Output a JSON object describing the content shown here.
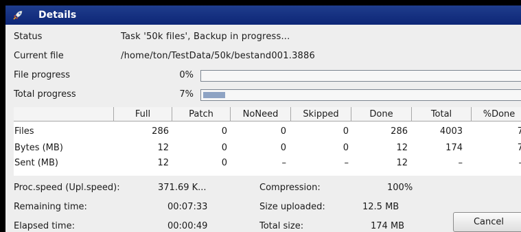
{
  "window": {
    "title": "Details",
    "icon": "rocket-icon"
  },
  "status": {
    "label": "Status",
    "value": "Task '50k files', Backup in progress..."
  },
  "current_file": {
    "label": "Current file",
    "value": "/home/ton/TestData/50k/bestand001.3886"
  },
  "file_progress": {
    "label": "File progress",
    "percent_text": "0%",
    "percent": 0
  },
  "total_progress": {
    "label": "Total progress",
    "percent_text": "7%",
    "percent": 7
  },
  "stats_table": {
    "columns": [
      "",
      "Full",
      "Patch",
      "NoNeed",
      "Skipped",
      "Done",
      "Total",
      "%Done"
    ],
    "rows": [
      {
        "label": "Files",
        "cells": [
          "286",
          "0",
          "0",
          "0",
          "286",
          "4003",
          "7"
        ]
      },
      {
        "label": "Bytes (MB)",
        "cells": [
          "12",
          "0",
          "0",
          "0",
          "12",
          "174",
          "7"
        ]
      },
      {
        "label": "Sent (MB)",
        "cells": [
          "12",
          "0",
          "–",
          "–",
          "12",
          "–",
          "–"
        ]
      }
    ]
  },
  "summary": {
    "proc_speed_label": "Proc.speed (Upl.speed):",
    "proc_speed_value": "371.69 K...",
    "remaining_label": "Remaining time:",
    "remaining_value": "00:07:33",
    "elapsed_label": "Elapsed time:",
    "elapsed_value": "00:00:49",
    "compression_label": "Compression:",
    "compression_value": "100%",
    "size_uploaded_label": "Size uploaded:",
    "size_uploaded_value": "12.5 MB",
    "total_size_label": "Total size:",
    "total_size_value": "174 MB"
  },
  "buttons": {
    "cancel": "Cancel"
  }
}
